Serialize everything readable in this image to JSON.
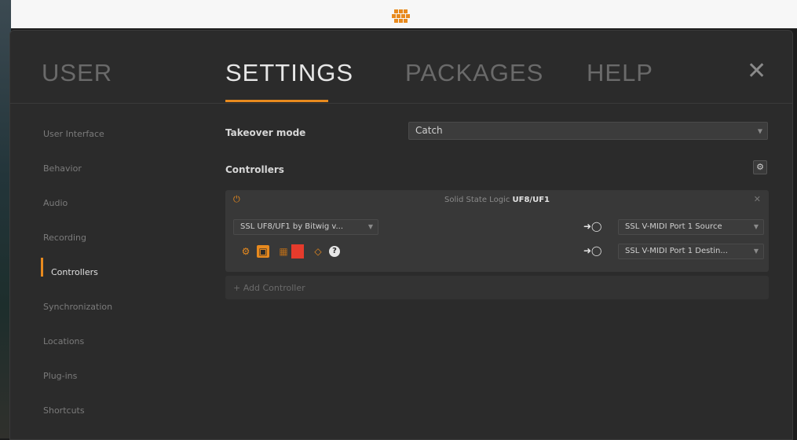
{
  "tabs": [
    {
      "label": "USER",
      "active": false
    },
    {
      "label": "SETTINGS",
      "active": true
    },
    {
      "label": "PACKAGES",
      "active": false
    },
    {
      "label": "HELP",
      "active": false
    }
  ],
  "close_label": "✕",
  "sidebar": {
    "items": [
      {
        "label": "User Interface",
        "active": false
      },
      {
        "label": "Behavior",
        "active": false
      },
      {
        "label": "Audio",
        "active": false
      },
      {
        "label": "Recording",
        "active": false
      },
      {
        "label": "Controllers",
        "active": true
      },
      {
        "label": "Synchronization",
        "active": false
      },
      {
        "label": "Locations",
        "active": false
      },
      {
        "label": "Plug-ins",
        "active": false
      },
      {
        "label": "Shortcuts",
        "active": false
      }
    ]
  },
  "settings": {
    "takeover_label": "Takeover mode",
    "takeover_value": "Catch",
    "controllers_label": "Controllers"
  },
  "controller": {
    "vendor": "Solid State Logic",
    "model": "UF8/UF1",
    "script": "SSL UF8/UF1 by Bitwig v...",
    "input_port": "SSL V-MIDI Port 1 Source",
    "output_port": "SSL V-MIDI Port 1 Destin..."
  },
  "add_controller_label": "+ Add Controller",
  "colors": {
    "accent": "#e88a1e",
    "dialog_bg": "#2b2b2b",
    "panel_bg": "#383838",
    "red_swatch": "#e53b2c"
  },
  "icons": [
    "bitwig-logo-icon",
    "close-icon",
    "gear-icon",
    "power-icon",
    "panel-close-icon",
    "midi-arrow-icon",
    "help-icon"
  ]
}
